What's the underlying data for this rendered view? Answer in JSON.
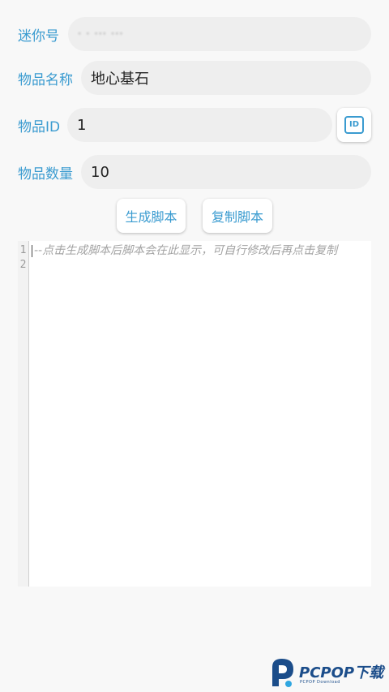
{
  "form": {
    "mini_number": {
      "label": "迷你号",
      "value": "· · ··· ···"
    },
    "item_name": {
      "label": "物品名称",
      "value": "地心基石"
    },
    "item_id": {
      "label": "物品ID",
      "value": "1",
      "button_icon_text": "ID"
    },
    "item_count": {
      "label": "物品数量",
      "value": "10"
    }
  },
  "buttons": {
    "generate": "生成脚本",
    "copy": "复制脚本"
  },
  "editor": {
    "line_numbers": [
      "1",
      "2"
    ],
    "placeholder": "--点击生成脚本后脚本会在此显示，可自行修改后再点击复制"
  },
  "watermark": {
    "brand": "PCPOP下载",
    "sub": "PCPOP Download"
  },
  "colors": {
    "accent": "#3a9bd0",
    "input_bg": "#eeeeee",
    "page_bg": "#f8f8f8",
    "watermark": "#1b4d8a"
  },
  "icons": {
    "id_button": "id-card-icon",
    "watermark_logo": "pcpop-logo-icon"
  }
}
